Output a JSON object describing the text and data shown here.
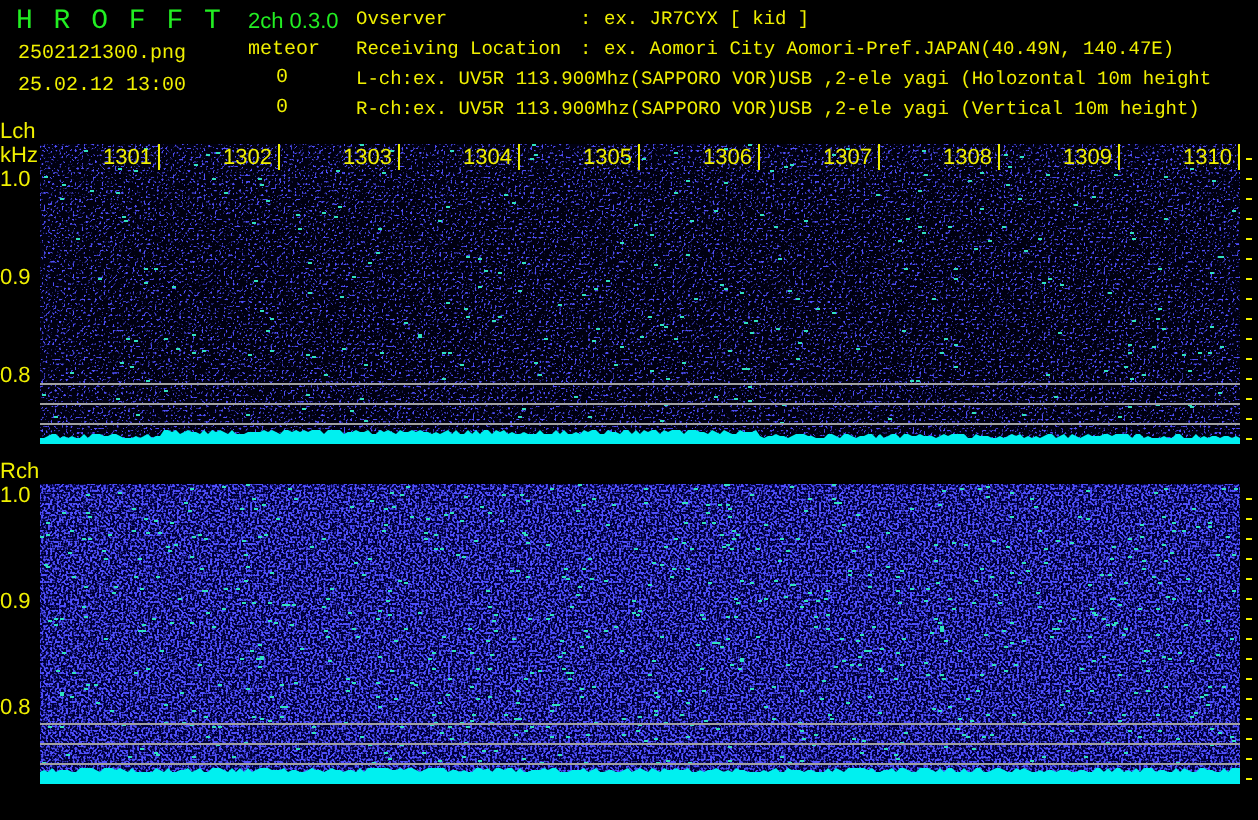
{
  "header": {
    "app_title": "H R O F F T",
    "version": "2ch 0.3.0",
    "filename": "2502121300.png",
    "datetime": "25.02.12 13:00",
    "meteor_label": "meteor",
    "meteor_counts": [
      "0",
      "0"
    ],
    "info": [
      {
        "label": "Ovserver",
        "separator": ":",
        "value": "ex. JR7CYX [ kid ]"
      },
      {
        "label": "Receiving Location",
        "separator": ":",
        "value": "ex. Aomori City Aomori-Pref.JAPAN(40.49N, 140.47E)"
      }
    ],
    "channel_lines": [
      "L-ch:ex. UV5R 113.900Mhz(SAPPORO VOR)USB ,2-ele yagi (Holozontal 10m height",
      "R-ch:ex. UV5R 113.900Mhz(SAPPORO VOR)USB ,2-ele yagi (Vertical 10m height)"
    ]
  },
  "channels": [
    {
      "label": "Lch",
      "unit": "kHz",
      "time_ticks": [
        "1301",
        "1302",
        "1303",
        "1304",
        "1305",
        "1306",
        "1307",
        "1308",
        "1309",
        "1310"
      ],
      "y_ticks": [
        "1.0",
        "0.9",
        "0.8"
      ]
    },
    {
      "label": "Rch",
      "y_ticks": [
        "1.0",
        "0.9",
        "0.8"
      ]
    }
  ]
}
